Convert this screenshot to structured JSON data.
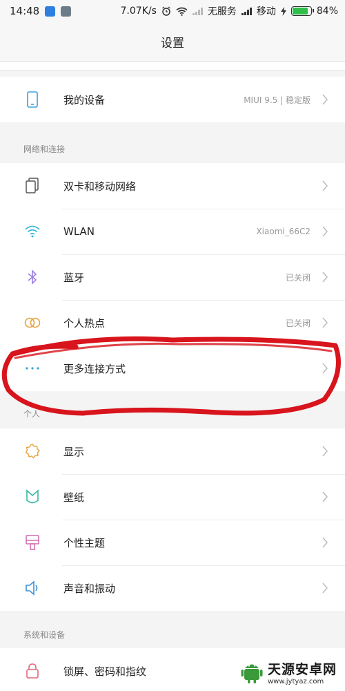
{
  "status_bar": {
    "time": "14:48",
    "speed": "7.07K/s",
    "no_service": "无服务",
    "carrier": "移动",
    "battery": "84%",
    "battery_level": 0.84
  },
  "title": "设置",
  "sections": {
    "top": {
      "items": [
        {
          "label": "我的设备",
          "value": "MIUI 9.5 | 稳定版",
          "icon": "phone-icon"
        }
      ]
    },
    "network": {
      "header": "网络和连接",
      "items": [
        {
          "label": "双卡和移动网络",
          "value": "",
          "icon": "sim-card-icon"
        },
        {
          "label": "WLAN",
          "value": "Xiaomi_66C2",
          "icon": "wifi-icon"
        },
        {
          "label": "蓝牙",
          "value": "已关闭",
          "icon": "bluetooth-icon"
        },
        {
          "label": "个人热点",
          "value": "已关闭",
          "icon": "hotspot-icon"
        },
        {
          "label": "更多连接方式",
          "value": "",
          "icon": "more-dots-icon"
        }
      ]
    },
    "personal": {
      "header": "个人",
      "items": [
        {
          "label": "显示",
          "value": "",
          "icon": "display-icon"
        },
        {
          "label": "壁纸",
          "value": "",
          "icon": "wallpaper-icon"
        },
        {
          "label": "个性主题",
          "value": "",
          "icon": "theme-icon"
        },
        {
          "label": "声音和振动",
          "value": "",
          "icon": "sound-icon"
        }
      ]
    },
    "system": {
      "header": "系统和设备",
      "items": [
        {
          "label": "锁屏、密码和指纹",
          "value": "",
          "icon": "lock-icon"
        }
      ]
    }
  },
  "watermark": {
    "brand": "天源安卓网",
    "url": "www.jytyaz.com"
  },
  "colors": {
    "annotation_red": "#d8141c",
    "wifi": "#35b6d8",
    "bluetooth": "#9b7fe0",
    "hotspot": "#e8a23c",
    "display": "#e8a23c",
    "wallpaper": "#3cb8a4",
    "theme": "#d26fb0",
    "sound": "#3a8fd8",
    "lock": "#e06a7a"
  }
}
